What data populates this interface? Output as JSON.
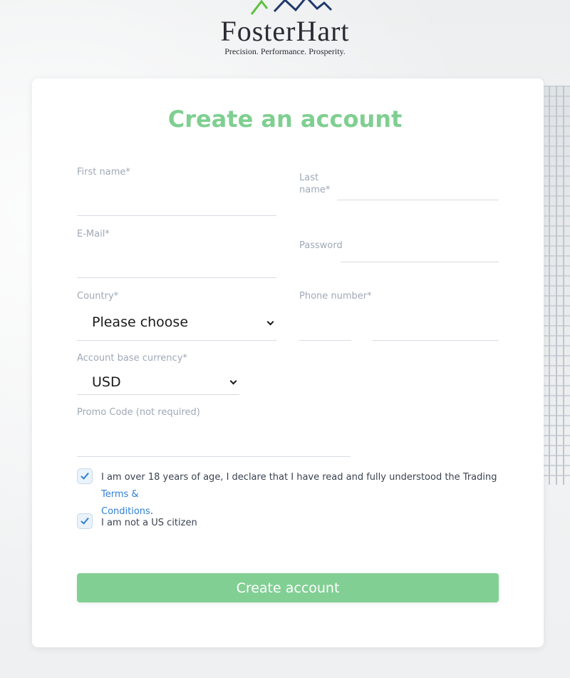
{
  "brand": {
    "name": "FosterHart",
    "tagline": "Precision. Performance. Prosperity."
  },
  "form": {
    "title": "Create an account",
    "fields": {
      "first_name": {
        "label": "First name*",
        "value": ""
      },
      "last_name": {
        "label_line1": "Last",
        "label_line2": "name*",
        "value": ""
      },
      "email": {
        "label": "E-Mail*",
        "value": ""
      },
      "password": {
        "label": "Password",
        "value": ""
      },
      "country": {
        "label": "Country*",
        "value": "Please choose"
      },
      "phone": {
        "label": "Phone number*",
        "code": "",
        "number": ""
      },
      "currency": {
        "label": "Account base currency*",
        "value": "USD"
      },
      "promo": {
        "label": "Promo Code (not required)",
        "value": ""
      }
    },
    "checkboxes": {
      "terms": {
        "checked": true,
        "text_line1": "I am over 18 years of age, I declare that I have read and fully understood the Trading ",
        "link_part1": "Terms &",
        "link_part2": "Conditions",
        "suffix": "."
      },
      "us_citizen": {
        "checked": true,
        "text": "I am not a US citizen"
      }
    },
    "submit_label": "Create account"
  },
  "colors": {
    "accent_green": "#7fcf91",
    "link_blue": "#2f7fd6",
    "label_gray": "#9fa9b7"
  }
}
